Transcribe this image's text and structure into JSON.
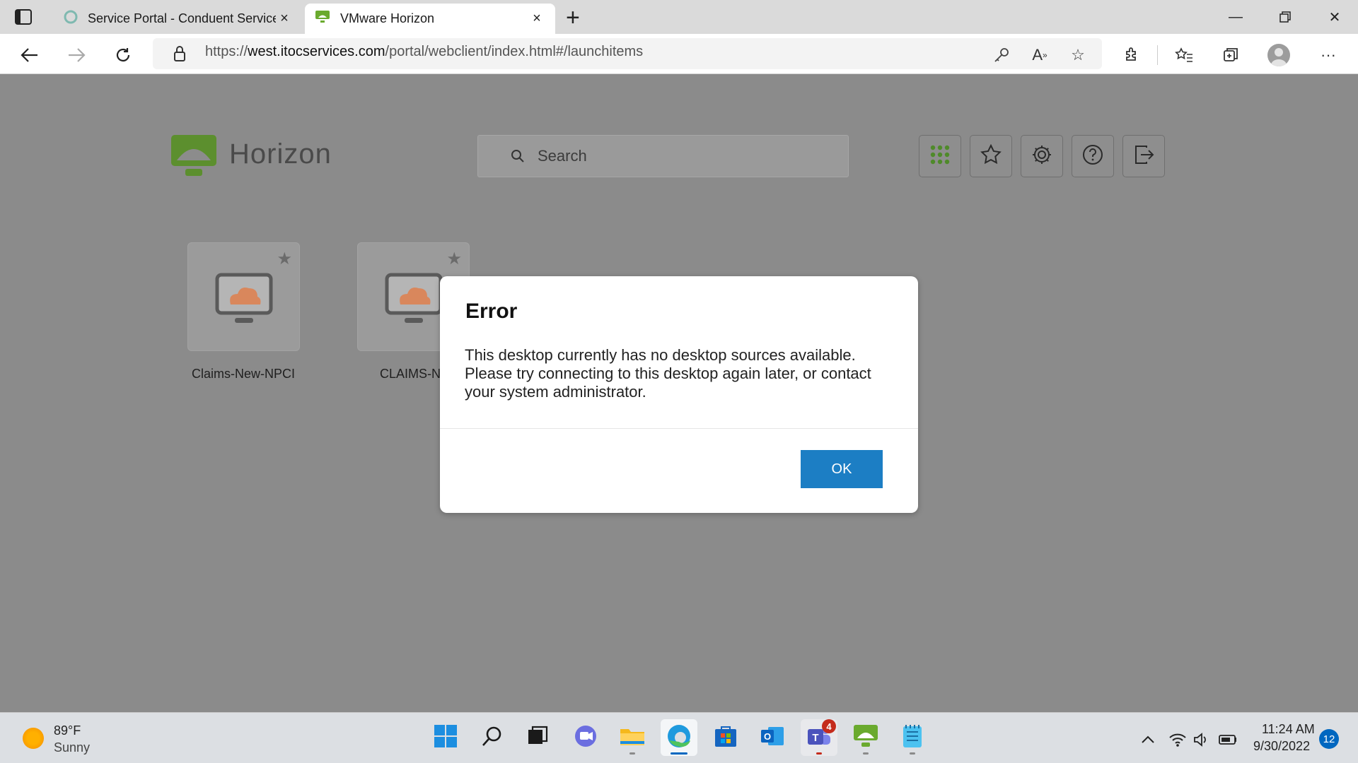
{
  "browser": {
    "tabs": [
      {
        "title": "Service Portal - Conduent Service",
        "close": "×"
      },
      {
        "title": "VMware Horizon",
        "close": "×"
      }
    ],
    "new_tab": "+",
    "url_scheme": "https://",
    "url_host": "west.itocservices.com",
    "url_path": "/portal/webclient/index.html#/launchitems"
  },
  "horizon": {
    "logo_text": "Horizon",
    "search_placeholder": "Search",
    "header_buttons": [
      "apps-grid-icon",
      "favorites-icon",
      "settings-icon",
      "help-icon",
      "logout-icon"
    ],
    "desktops": [
      {
        "label": "Claims-New-NPCI"
      },
      {
        "label": "CLAIMS-NP"
      }
    ]
  },
  "dialog": {
    "title": "Error",
    "message": "This desktop currently has no desktop sources available. Please try connecting to this desktop again later, or contact your system administrator.",
    "ok_label": "OK"
  },
  "taskbar": {
    "weather_temp": "89°F",
    "weather_condition": "Sunny",
    "teams_badge": "4",
    "clock_time": "11:24 AM",
    "clock_date": "9/30/2022",
    "notifications": "12"
  },
  "colors": {
    "horizon_green": "#6aaa2e",
    "ok_button": "#1c7ec4",
    "cloud_orange": "#d9875c"
  }
}
